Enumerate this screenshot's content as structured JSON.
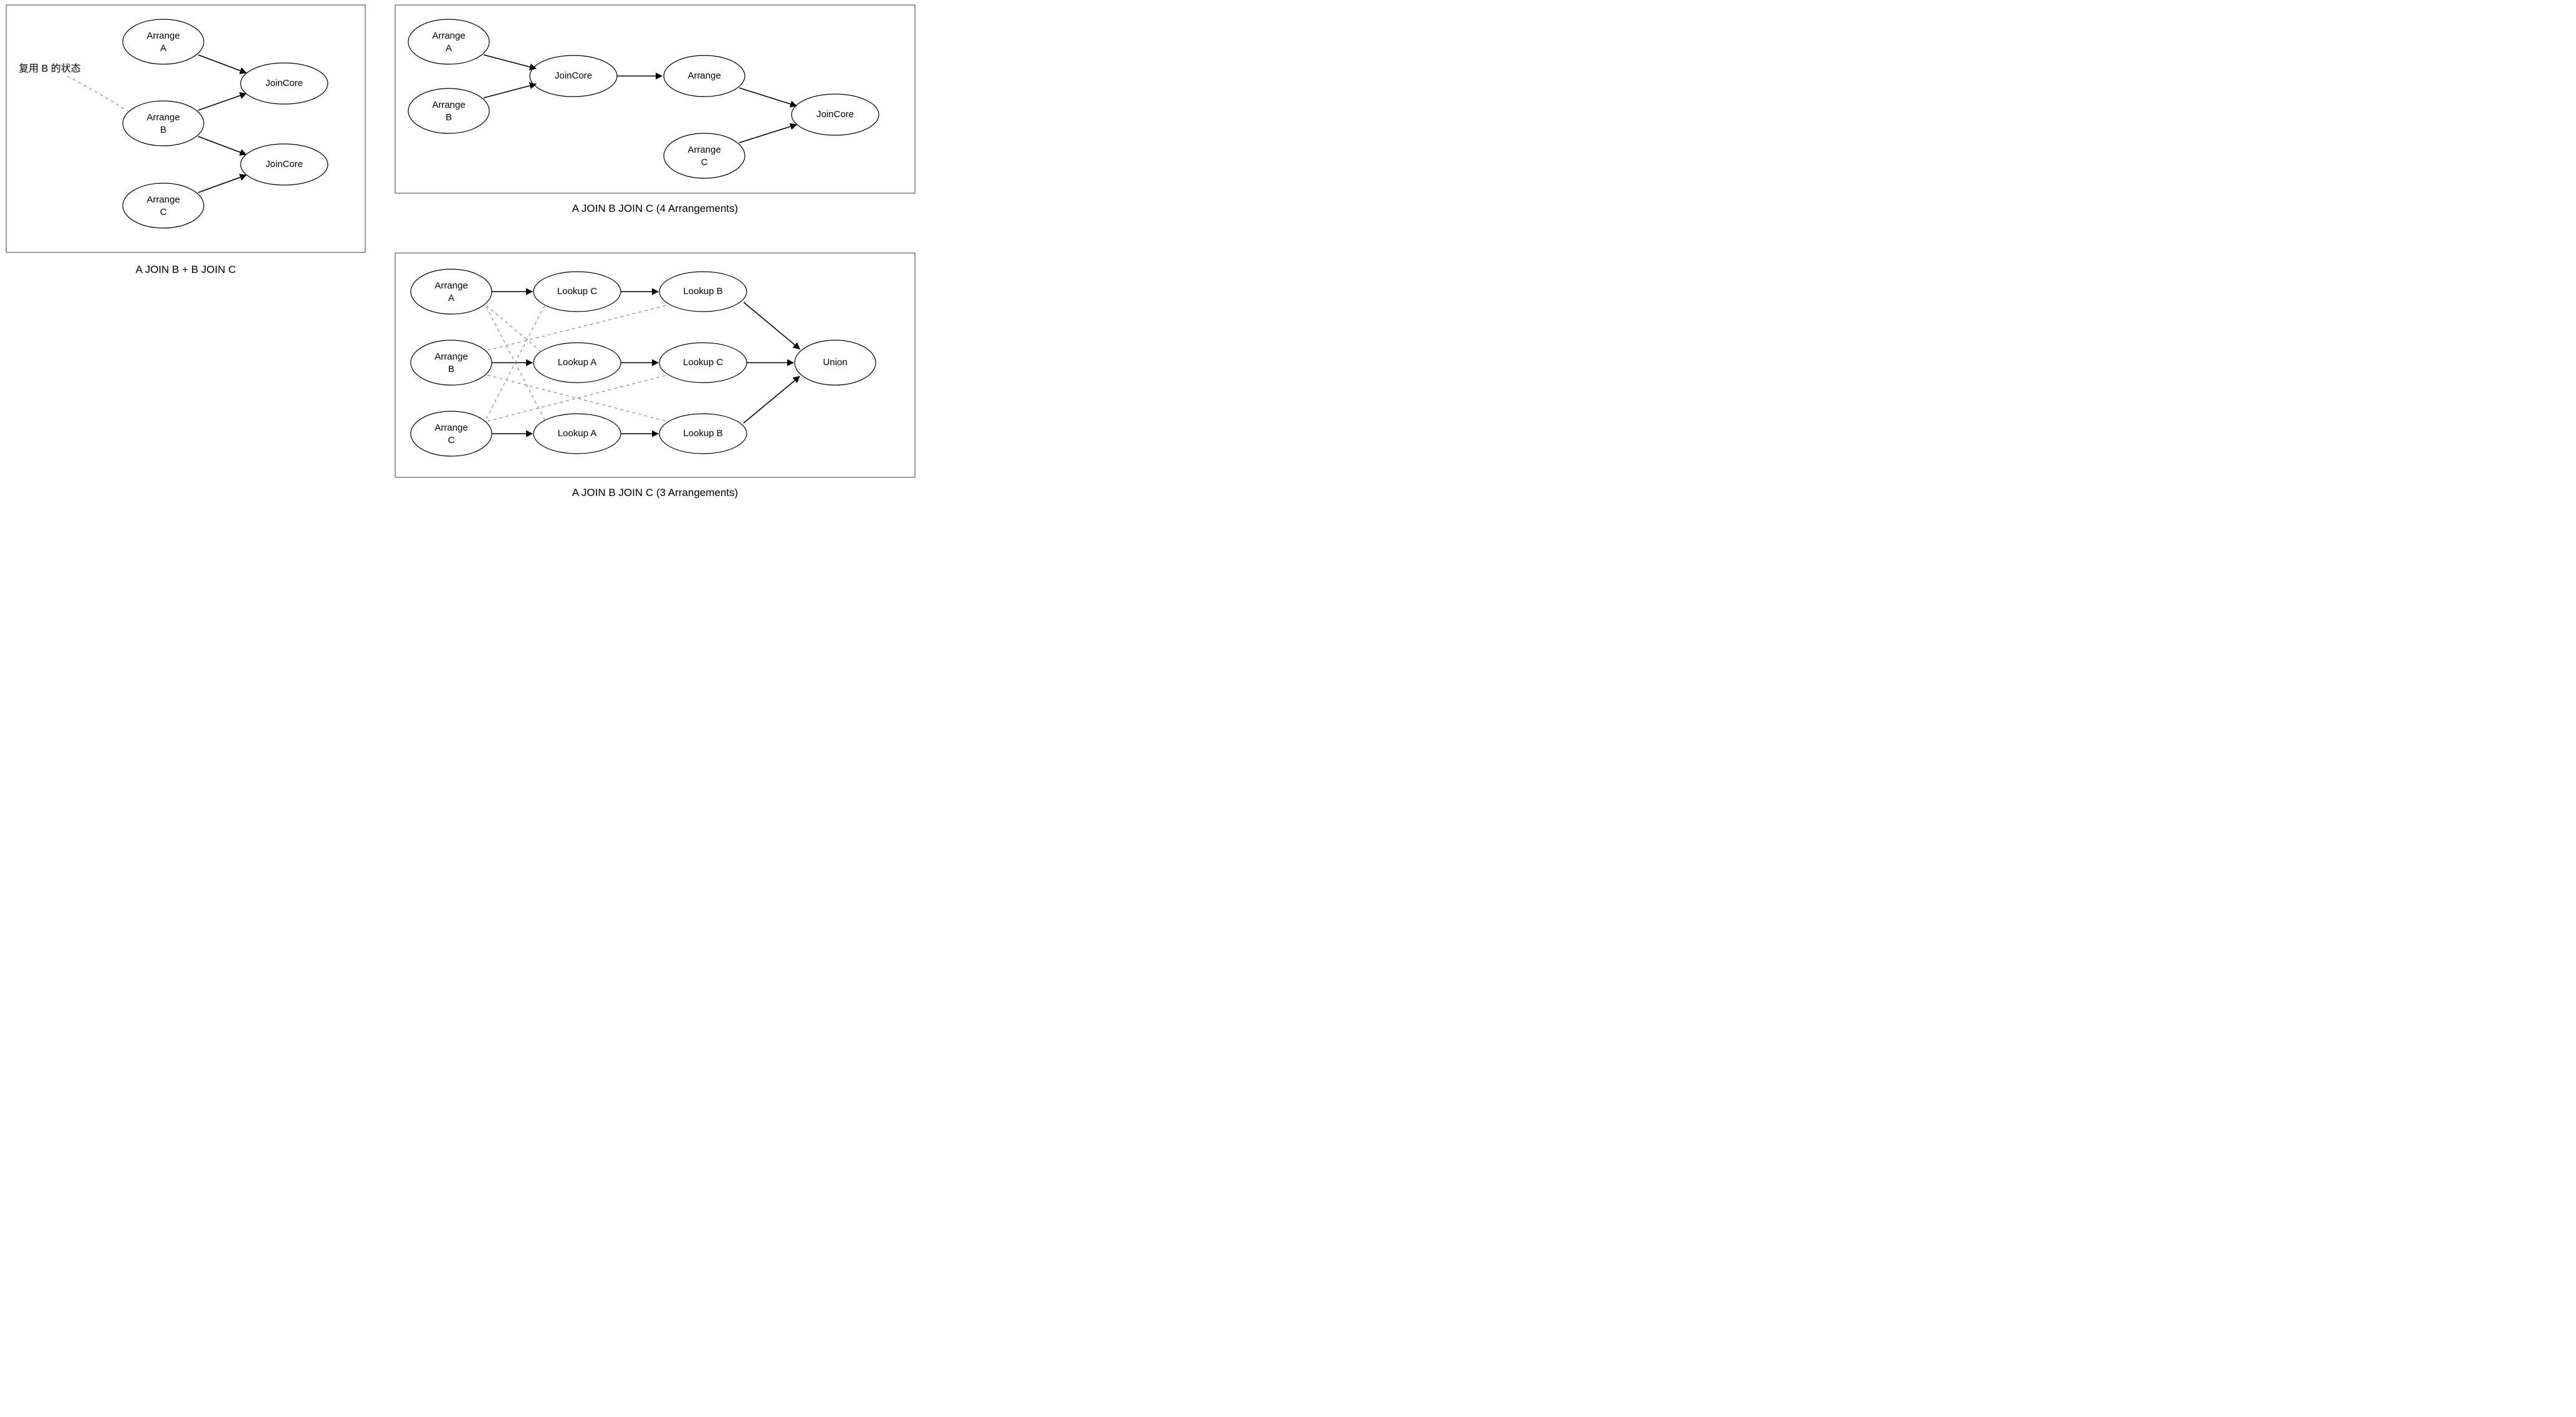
{
  "diagrams": {
    "left": {
      "caption": "A JOIN B + B JOIN C",
      "annotation": "复用 B 的状态",
      "nodes": {
        "arrA": {
          "l1": "Arrange",
          "l2": "A"
        },
        "arrB": {
          "l1": "Arrange",
          "l2": "B"
        },
        "arrC": {
          "l1": "Arrange",
          "l2": "C"
        },
        "jc1": {
          "l1": "JoinCore"
        },
        "jc2": {
          "l1": "JoinCore"
        }
      }
    },
    "topRight": {
      "caption": "A JOIN B JOIN C (4 Arrangements)",
      "nodes": {
        "arrA": {
          "l1": "Arrange",
          "l2": "A"
        },
        "arrB": {
          "l1": "Arrange",
          "l2": "B"
        },
        "arrC": {
          "l1": "Arrange",
          "l2": "C"
        },
        "arr": {
          "l1": "Arrange"
        },
        "jc1": {
          "l1": "JoinCore"
        },
        "jc2": {
          "l1": "JoinCore"
        }
      }
    },
    "bottomRight": {
      "caption": "A JOIN B JOIN C (3 Arrangements)",
      "nodes": {
        "arrA": {
          "l1": "Arrange",
          "l2": "A"
        },
        "arrB": {
          "l1": "Arrange",
          "l2": "B"
        },
        "arrC": {
          "l1": "Arrange",
          "l2": "C"
        },
        "lkC1": {
          "l1": "Lookup C"
        },
        "lkB1": {
          "l1": "Lookup B"
        },
        "lkA1": {
          "l1": "Lookup A"
        },
        "lkC2": {
          "l1": "Lookup C"
        },
        "lkA2": {
          "l1": "Lookup A"
        },
        "lkB2": {
          "l1": "Lookup B"
        },
        "union": {
          "l1": "Union"
        }
      }
    }
  }
}
